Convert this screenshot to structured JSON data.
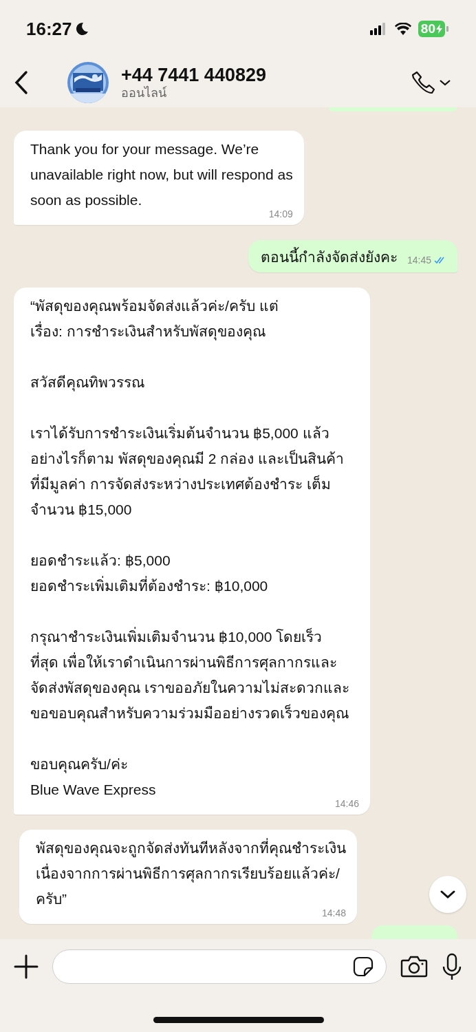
{
  "status_bar": {
    "time": "16:27",
    "battery": "80"
  },
  "header": {
    "title": "+44 7441 440829",
    "subtitle": "ออนไลน์"
  },
  "messages": [
    {
      "kind": "incoming",
      "text": "Thank you for your message. We’re\nunavailable right now, but will respond as\nsoon as possible.",
      "time": "14:09",
      "tail": true
    },
    {
      "kind": "outgoing",
      "text": "ตอนนี้กำลังจัดส่งยังคะ",
      "time": "14:45",
      "read": true,
      "tail": true
    },
    {
      "kind": "incoming",
      "text": "“พัสดุของคุณพร้อมจัดส่งแล้วค่ะ/ครับ แต่\nเรื่อง: การชำระเงินสำหรับพัสดุของคุณ\n\nสวัสดีคุณทิพวรรณ\n\nเราได้รับการชำระเงินเริ่มต้นจำนวน ฿5,000 แล้ว\nอย่างไรก็ตาม พัสดุของคุณมี 2 กล่อง และเป็นสินค้า\nที่มีมูลค่า การจัดส่งระหว่างประเทศต้องชำระ เต็ม\nจำนวน ฿15,000\n\nยอดชำระแล้ว: ฿5,000\nยอดชำระเพิ่มเติมที่ต้องชำระ: ฿10,000\n\nกรุณาชำระเงินเพิ่มเติมจำนวน ฿10,000 โดยเร็ว\nที่สุด เพื่อให้เราดำเนินการผ่านพิธีการศุลกากรและ\nจัดส่งพัสดุของคุณ เราขออภัยในความไม่สะดวกและ\nขอขอบคุณสำหรับความร่วมมืออย่างรวดเร็วของคุณ\n\nขอบคุณครับ/ค่ะ\nBlue Wave Express",
      "time": "14:46",
      "tail": true
    },
    {
      "kind": "incoming",
      "text": "พัสดุของคุณจะถูกจัดส่งทันทีหลังจากที่คุณชำระเงิน\nเนื่องจากการผ่านพิธีการศุลกากรเรียบร้อยแล้วค่ะ/\nครับ”",
      "time": "14:48",
      "tail": false
    }
  ]
}
